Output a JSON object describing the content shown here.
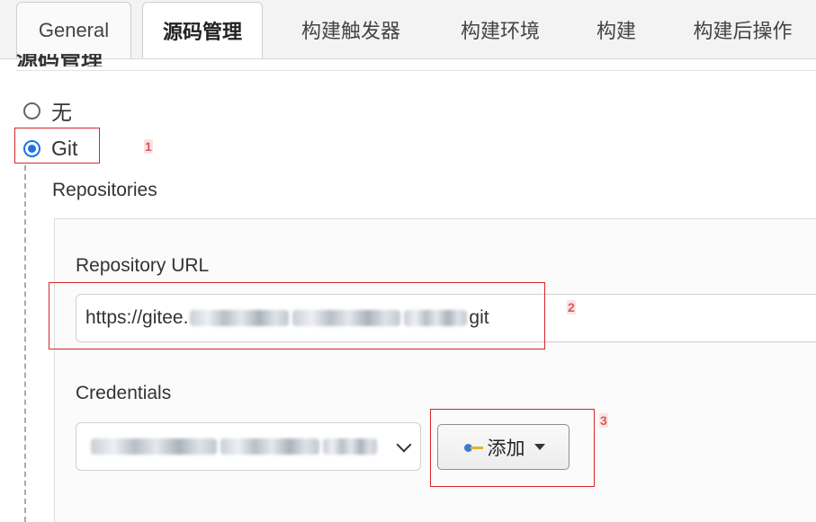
{
  "tabs": [
    {
      "label": "General"
    },
    {
      "label": "源码管理"
    },
    {
      "label": "构建触发器"
    },
    {
      "label": "构建环境"
    },
    {
      "label": "构建"
    },
    {
      "label": "构建后操作"
    }
  ],
  "section": {
    "title": "源码管理"
  },
  "scm_options": [
    {
      "label": "无",
      "selected": false
    },
    {
      "label": "Git",
      "selected": true
    }
  ],
  "repositories": {
    "heading": "Repositories",
    "url_label": "Repository URL",
    "url_prefix": "https://gitee.",
    "url_suffix": "git",
    "credentials_label": "Credentials",
    "add_button_label": "添加"
  },
  "annotations": [
    "1",
    "2",
    "3"
  ],
  "colors": {
    "highlight_red": "#d9252c",
    "radio_blue": "#1a73e8"
  }
}
